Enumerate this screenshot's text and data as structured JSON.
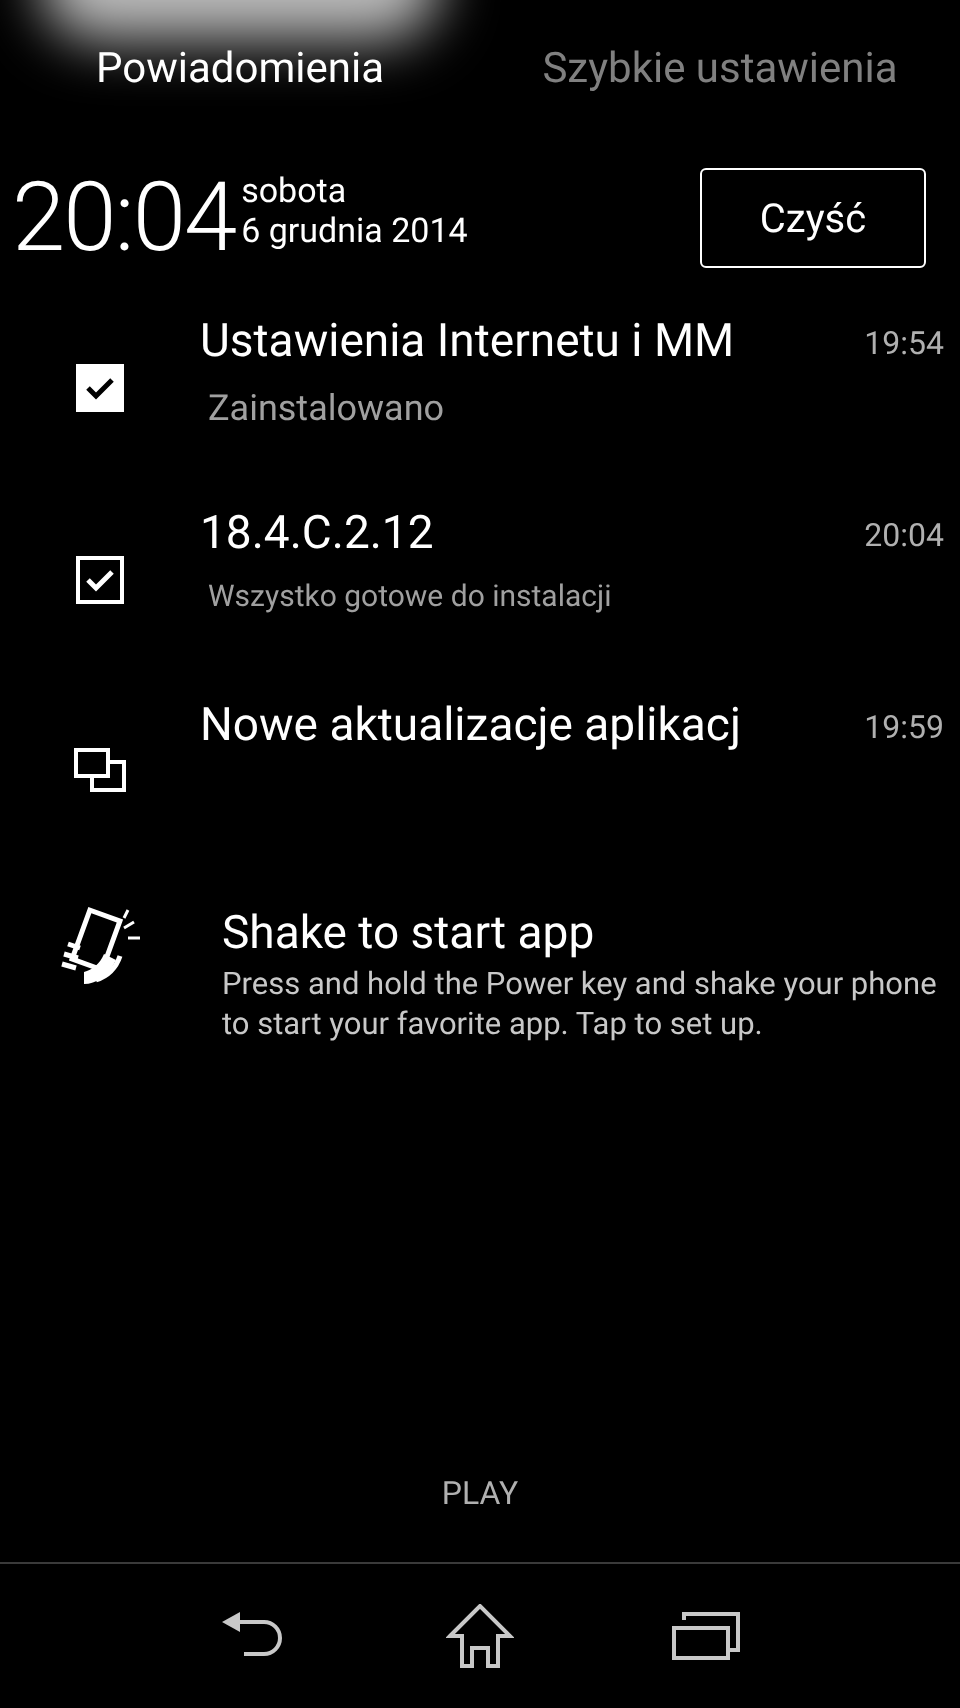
{
  "tabs": [
    {
      "label": "Powiadomienia",
      "selected": true
    },
    {
      "label": "Szybkie ustawienia",
      "selected": false
    }
  ],
  "clock": {
    "time": "20:04",
    "day": "sobota",
    "date": "6 grudnia 2014"
  },
  "clear_button": "Czyść",
  "notifications": [
    {
      "kind": "check-filled",
      "title": "Ustawienia Internetu i MM",
      "time": "19:54",
      "text": "Zainstalowano"
    },
    {
      "kind": "check-outline",
      "title": "18.4.C.2.12",
      "time": "20:04",
      "text": "Wszystko gotowe do instalacji"
    },
    {
      "kind": "windows",
      "title": "Nowe aktualizacje aplikacj",
      "time": "19:59"
    }
  ],
  "shake": {
    "title": "Shake to start app",
    "text": "Press and hold the Power key and shake your phone to start your favorite app. Tap to set up."
  },
  "carrier": "PLAY"
}
